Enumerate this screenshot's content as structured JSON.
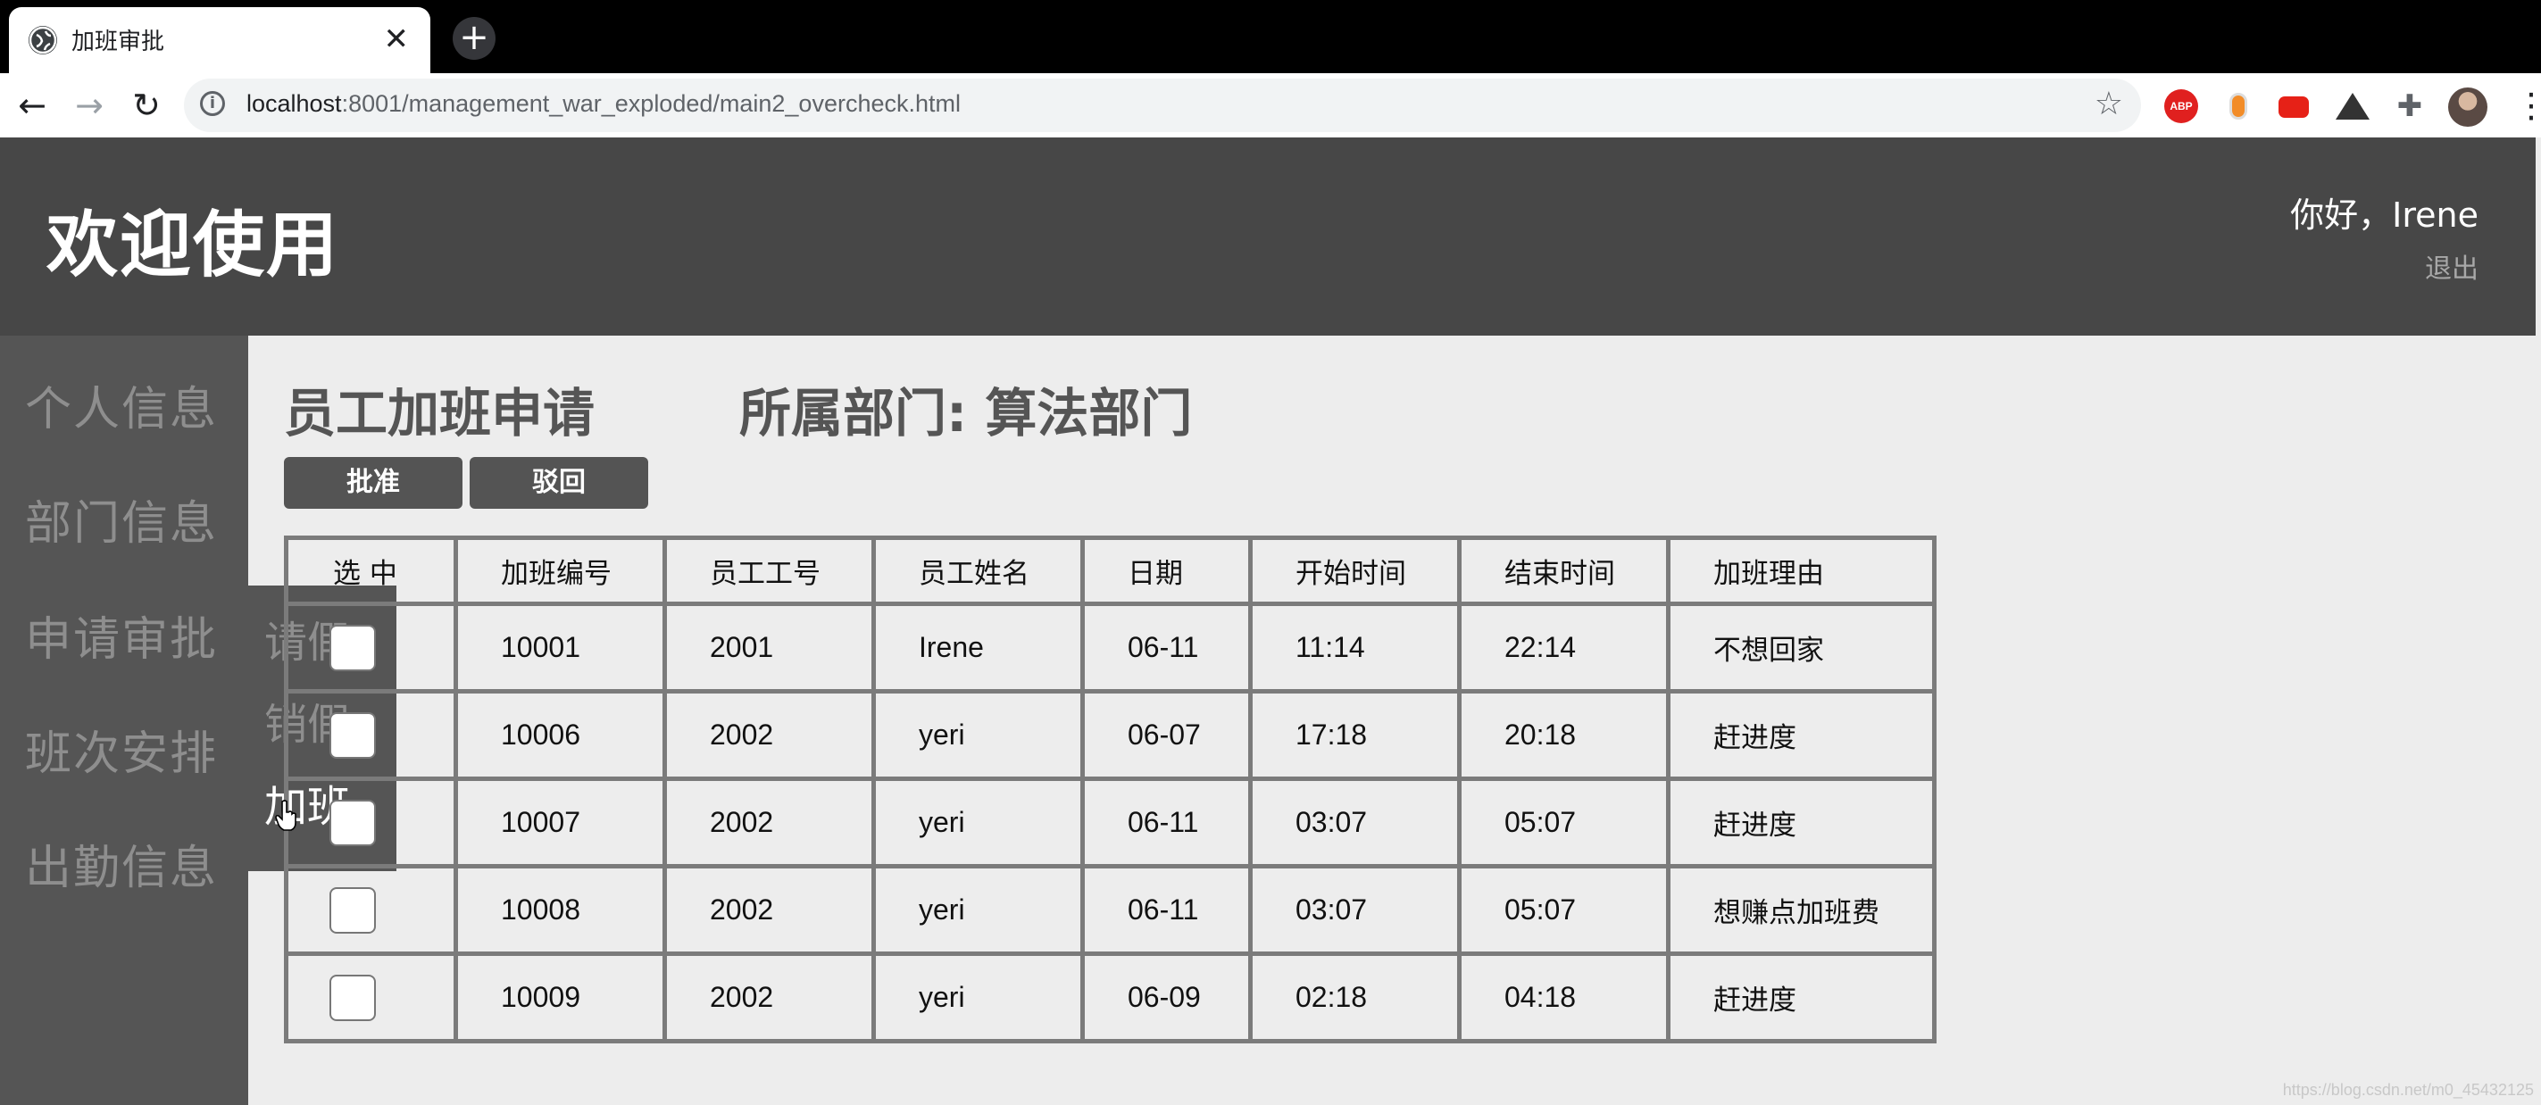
{
  "browser": {
    "tab_title": "加班审批",
    "tab_close": "✕",
    "new_tab": "+",
    "url_host": "localhost",
    "url_rest": ":8001/management_war_exploded/main2_overcheck.html",
    "back_icon": "←",
    "forward_icon": "→",
    "reload_icon": "↻",
    "info_icon": "i",
    "star_icon": "☆",
    "extensions": [
      "abp-icon",
      "orange-extension-icon",
      "youtube-extension-icon",
      "mountain-extension-icon",
      "puzzle-icon"
    ],
    "abp_label": "ABP",
    "puzzle_glyph": "✚",
    "menu_icon": "⋮"
  },
  "header": {
    "welcome": "欢迎使用",
    "greeting": "你好，Irene",
    "logout": "退出"
  },
  "sidebar": {
    "items": [
      {
        "label": "个人信息"
      },
      {
        "label": "部门信息"
      },
      {
        "label": "申请审批"
      },
      {
        "label": "班次安排"
      },
      {
        "label": "出勤信息"
      }
    ],
    "submenu": [
      {
        "label": "请假"
      },
      {
        "label": "销假"
      },
      {
        "label": "加班"
      }
    ]
  },
  "main": {
    "title": "员工加班申请",
    "department": "所属部门: 算法部门",
    "approve_label": "批准",
    "reject_label": "驳回",
    "columns": [
      "选  中",
      "加班编号",
      "员工工号",
      "员工姓名",
      "日期",
      "开始时间",
      "结束时间",
      "加班理由"
    ],
    "rows": [
      {
        "id": "10001",
        "emp_no": "2001",
        "name": "Irene",
        "date": "06-11",
        "start": "11:14",
        "end": "22:14",
        "reason": "不想回家"
      },
      {
        "id": "10006",
        "emp_no": "2002",
        "name": "yeri",
        "date": "06-07",
        "start": "17:18",
        "end": "20:18",
        "reason": "赶进度"
      },
      {
        "id": "10007",
        "emp_no": "2002",
        "name": "yeri",
        "date": "06-11",
        "start": "03:07",
        "end": "05:07",
        "reason": "赶进度"
      },
      {
        "id": "10008",
        "emp_no": "2002",
        "name": "yeri",
        "date": "06-11",
        "start": "03:07",
        "end": "05:07",
        "reason": "想赚点加班费"
      },
      {
        "id": "10009",
        "emp_no": "2002",
        "name": "yeri",
        "date": "06-09",
        "start": "02:18",
        "end": "04:18",
        "reason": "赶进度"
      }
    ]
  },
  "watermark": "https://blog.csdn.net/m0_45432125"
}
